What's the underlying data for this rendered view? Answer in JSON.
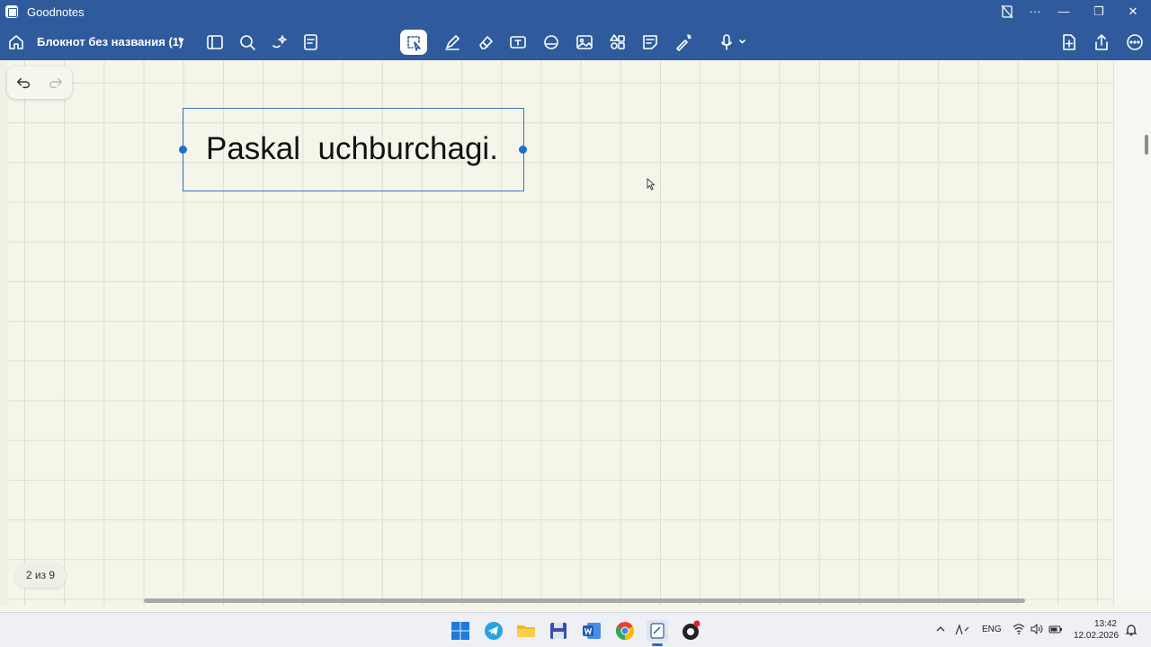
{
  "window": {
    "app_name": "Goodnotes"
  },
  "window_controls": {
    "fit": "🗋",
    "more": "···",
    "minimize": "—",
    "restore": "❐",
    "close": "✕"
  },
  "toolbar": {
    "notebook_title": "Блокнот без названия (1)"
  },
  "document": {
    "text_box": "Paskal  uchburchagi."
  },
  "page_indicator": "2 из 9",
  "tray": {
    "language": "ENG",
    "time": "13:42",
    "date": "12.02.2026"
  },
  "colors": {
    "header": "#2f5b9c",
    "paper": "#f5f6e9",
    "grid": "#dcdfd2",
    "selection": "#3a72c4"
  }
}
